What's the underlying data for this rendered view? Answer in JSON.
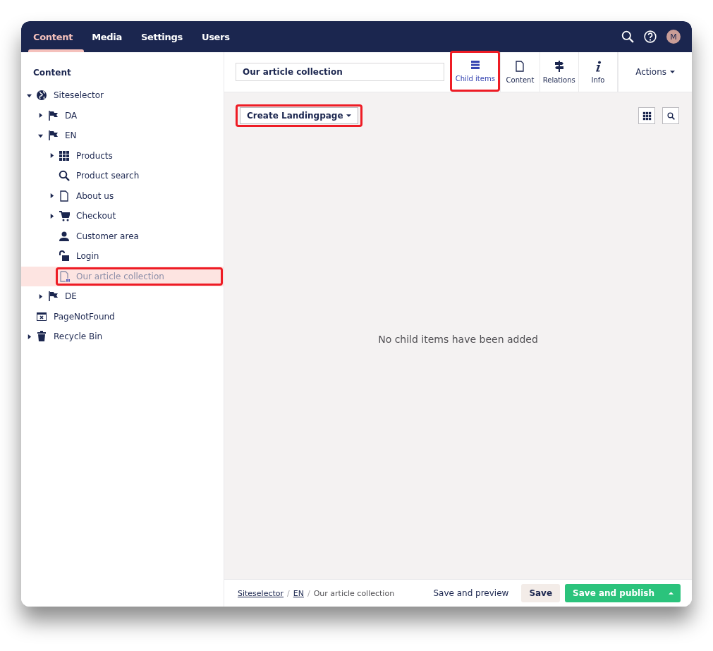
{
  "top_nav": {
    "sections": [
      {
        "label": "Content",
        "selected": true
      },
      {
        "label": "Media",
        "selected": false
      },
      {
        "label": "Settings",
        "selected": false
      },
      {
        "label": "Users",
        "selected": false
      }
    ],
    "avatar": "M"
  },
  "sidebar": {
    "title": "Content",
    "tree": [
      {
        "label": "Siteselector",
        "expanded": true,
        "selected": false,
        "highlighted": false,
        "children": [
          {
            "label": "DA",
            "expanded": false,
            "selected": false,
            "highlighted": false
          },
          {
            "label": "EN",
            "expanded": true,
            "selected": false,
            "highlighted": false,
            "children": [
              {
                "label": "Products",
                "expanded": false,
                "selected": false,
                "highlighted": false
              },
              {
                "label": "Product search",
                "selected": false,
                "highlighted": false
              },
              {
                "label": "About us",
                "expanded": false,
                "selected": false,
                "highlighted": false
              },
              {
                "label": "Checkout",
                "expanded": false,
                "selected": false,
                "highlighted": false
              },
              {
                "label": "Customer area",
                "selected": false,
                "highlighted": false
              },
              {
                "label": "Login",
                "selected": false,
                "highlighted": false
              },
              {
                "label": "Our article collection",
                "selected": true,
                "highlighted": true
              }
            ]
          },
          {
            "label": "DE",
            "expanded": false,
            "selected": false,
            "highlighted": false
          }
        ]
      },
      {
        "label": "PageNotFound",
        "selected": false,
        "highlighted": false
      },
      {
        "label": "Recycle Bin",
        "expanded": false,
        "selected": false,
        "highlighted": false
      }
    ]
  },
  "editor": {
    "name_value": "Our article collection",
    "apps": [
      {
        "label": "Child items",
        "selected": true,
        "highlighted": true
      },
      {
        "label": "Content",
        "selected": false,
        "highlighted": false
      },
      {
        "label": "Relations",
        "selected": false,
        "highlighted": false
      },
      {
        "label": "Info",
        "selected": false,
        "highlighted": false
      }
    ],
    "actions": "Actions",
    "create_button": {
      "label": "Create Landingpage",
      "highlighted": true
    },
    "empty_message": "No child items have been added",
    "breadcrumbs": [
      {
        "kind": "link",
        "label": "Siteselector"
      },
      {
        "kind": "separator",
        "label": "/"
      },
      {
        "kind": "link",
        "label": "EN"
      },
      {
        "kind": "separator",
        "label": "/"
      },
      {
        "kind": "current",
        "label": "Our article collection"
      }
    ],
    "buttons": {
      "preview": "Save and preview",
      "save": "Save",
      "publish": "Save and publish"
    }
  }
}
